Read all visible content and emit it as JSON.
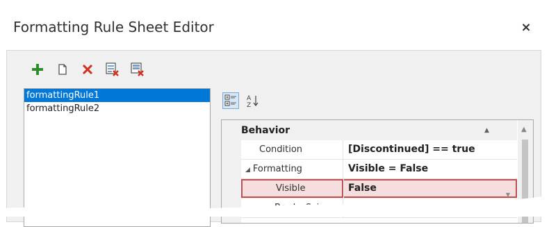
{
  "window": {
    "title": "Formatting Rule Sheet Editor",
    "close_label": "×"
  },
  "toolbar": {
    "buttons": [
      {
        "icon": "add-icon",
        "color": "#2e8b2e"
      },
      {
        "icon": "copy-icon",
        "color": "#505050"
      },
      {
        "icon": "delete-icon",
        "color": "#d03020"
      },
      {
        "icon": "delete-rule-icon",
        "color": "#d03020"
      },
      {
        "icon": "delete-all-icon",
        "color": "#d03020"
      }
    ]
  },
  "rules": {
    "items": [
      "formattingRule1",
      "formattingRule2"
    ],
    "selected_index": 0,
    "selection_color": "#0078d7"
  },
  "property_grid": {
    "toolbar": [
      {
        "icon": "categorized-icon",
        "pressed": true
      },
      {
        "icon": "alphabetical-sort-icon",
        "label": "A↓Z",
        "pressed": false
      }
    ],
    "category": "Behavior",
    "rows": [
      {
        "name": "Condition",
        "value": "[Discontinued] == true",
        "expander": ""
      },
      {
        "name": "Formatting",
        "value": "Visible = False",
        "expander": "◢"
      },
      {
        "name": "Visible",
        "value": "False",
        "expander": "",
        "dropdown": true
      },
      {
        "name": "BorderColor",
        "value": "",
        "expander": ""
      }
    ],
    "selected_row": 2,
    "highlight_color": "#c05050"
  }
}
